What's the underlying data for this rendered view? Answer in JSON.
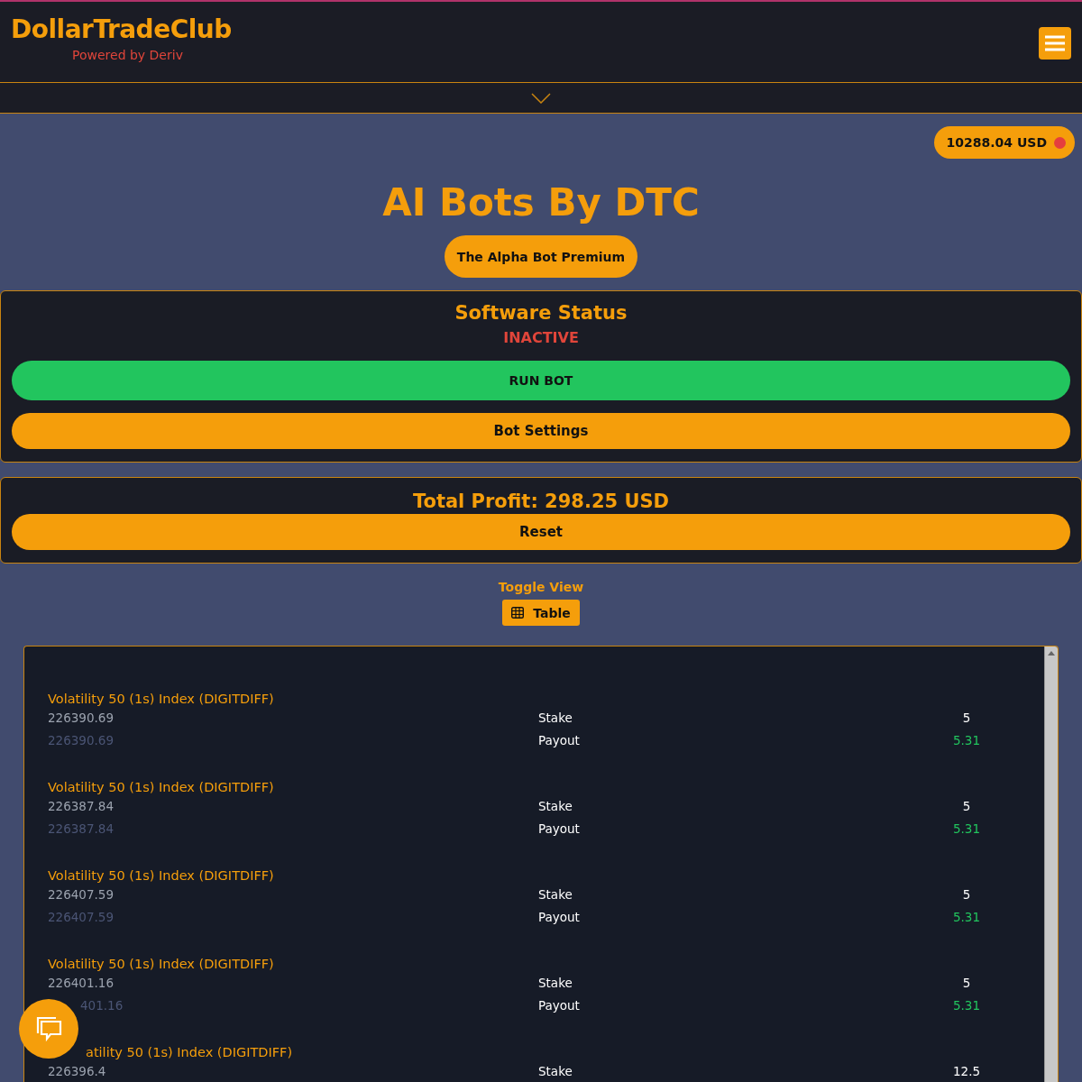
{
  "header": {
    "brand": "DollarTradeClub",
    "tagline": "Powered by Deriv"
  },
  "balance": {
    "amount": "10288.04 USD"
  },
  "title": "AI Bots By DTC",
  "bot_button": "The Alpha Bot Premium",
  "status_panel": {
    "heading": "Software Status",
    "status": "INACTIVE",
    "run_button": "RUN BOT",
    "settings_button": "Bot Settings"
  },
  "profit_panel": {
    "total": "Total Profit: 298.25 USD",
    "reset_button": "Reset"
  },
  "view_toggle": {
    "label": "Toggle View",
    "button": "Table"
  },
  "trades": [
    {
      "contract": "Volatility 50 (1s) Index (DIGITDIFF)",
      "entry": "226390.69",
      "exit": "226390.69",
      "stake_label": "Stake",
      "stake": "5",
      "payout_label": "Payout",
      "payout": "5.31"
    },
    {
      "contract": "Volatility 50 (1s) Index (DIGITDIFF)",
      "entry": "226387.84",
      "exit": "226387.84",
      "stake_label": "Stake",
      "stake": "5",
      "payout_label": "Payout",
      "payout": "5.31"
    },
    {
      "contract": "Volatility 50 (1s) Index (DIGITDIFF)",
      "entry": "226407.59",
      "exit": "226407.59",
      "stake_label": "Stake",
      "stake": "5",
      "payout_label": "Payout",
      "payout": "5.31"
    },
    {
      "contract": "Volatility 50 (1s) Index (DIGITDIFF)",
      "entry": "226401.16",
      "exit": "401.16",
      "exit_cut": true,
      "stake_label": "Stake",
      "stake": "5",
      "payout_label": "Payout",
      "payout": "5.31"
    },
    {
      "contract": "atility 50 (1s) Index (DIGITDIFF)",
      "contract_cut": true,
      "entry": "226396.4",
      "stake_label": "Stake",
      "stake": "12.5"
    }
  ]
}
